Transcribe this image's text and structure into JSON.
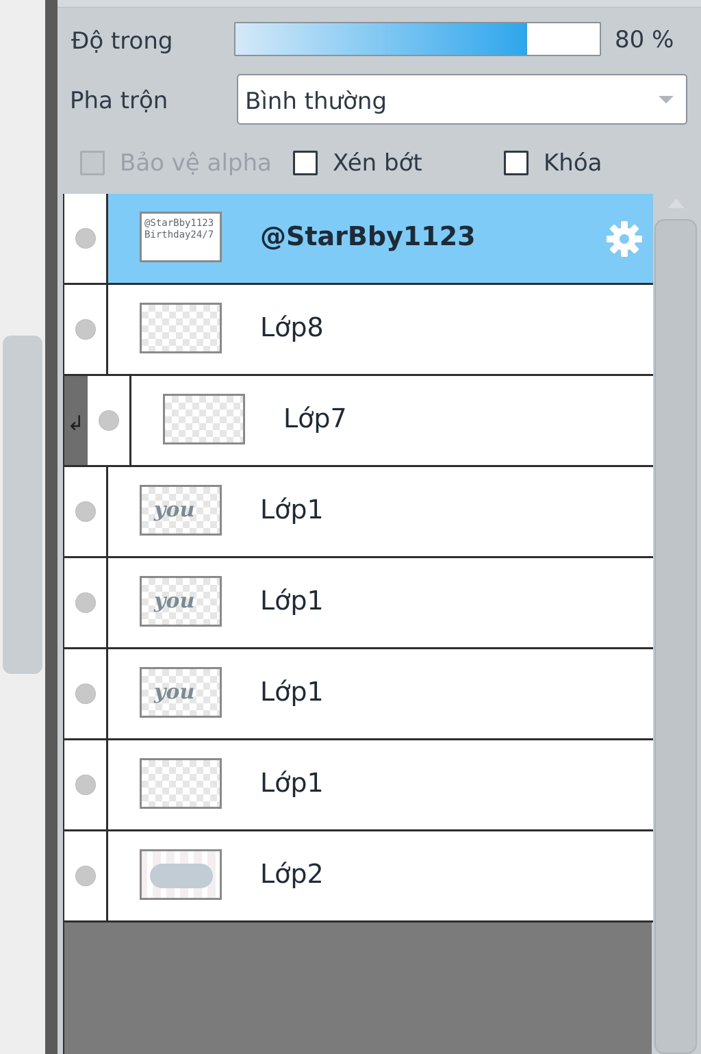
{
  "opacity": {
    "label": "Độ trong",
    "value_text": "80 %",
    "value": 0.8
  },
  "blend": {
    "label": "Pha trộn",
    "selected": "Bình thường"
  },
  "options": {
    "protect_alpha": {
      "label": "Bảo vệ alpha",
      "checked": false,
      "disabled": true
    },
    "clip": {
      "label": "Xén bớt",
      "checked": false,
      "disabled": false
    },
    "lock": {
      "label": "Khóa",
      "checked": false,
      "disabled": false
    }
  },
  "layers": [
    {
      "name": "@StarBby1123",
      "selected": true,
      "thumb_text": [
        "@StarBby1123",
        "Birthday24/7"
      ],
      "icon": "gear-icon"
    },
    {
      "name": "Lớp8",
      "selected": false
    },
    {
      "name": "Lớp7",
      "selected": false,
      "clipped": true
    },
    {
      "name": "Lớp1",
      "selected": false,
      "thumb_script": "you"
    },
    {
      "name": "Lớp1",
      "selected": false,
      "thumb_script": "you"
    },
    {
      "name": "Lớp1",
      "selected": false,
      "thumb_script": "you"
    },
    {
      "name": "Lớp1",
      "selected": false
    },
    {
      "name": "Lớp2",
      "selected": false
    }
  ],
  "colors": {
    "selected_row": "#7ecbf7",
    "accent": "#2ea6ec"
  }
}
